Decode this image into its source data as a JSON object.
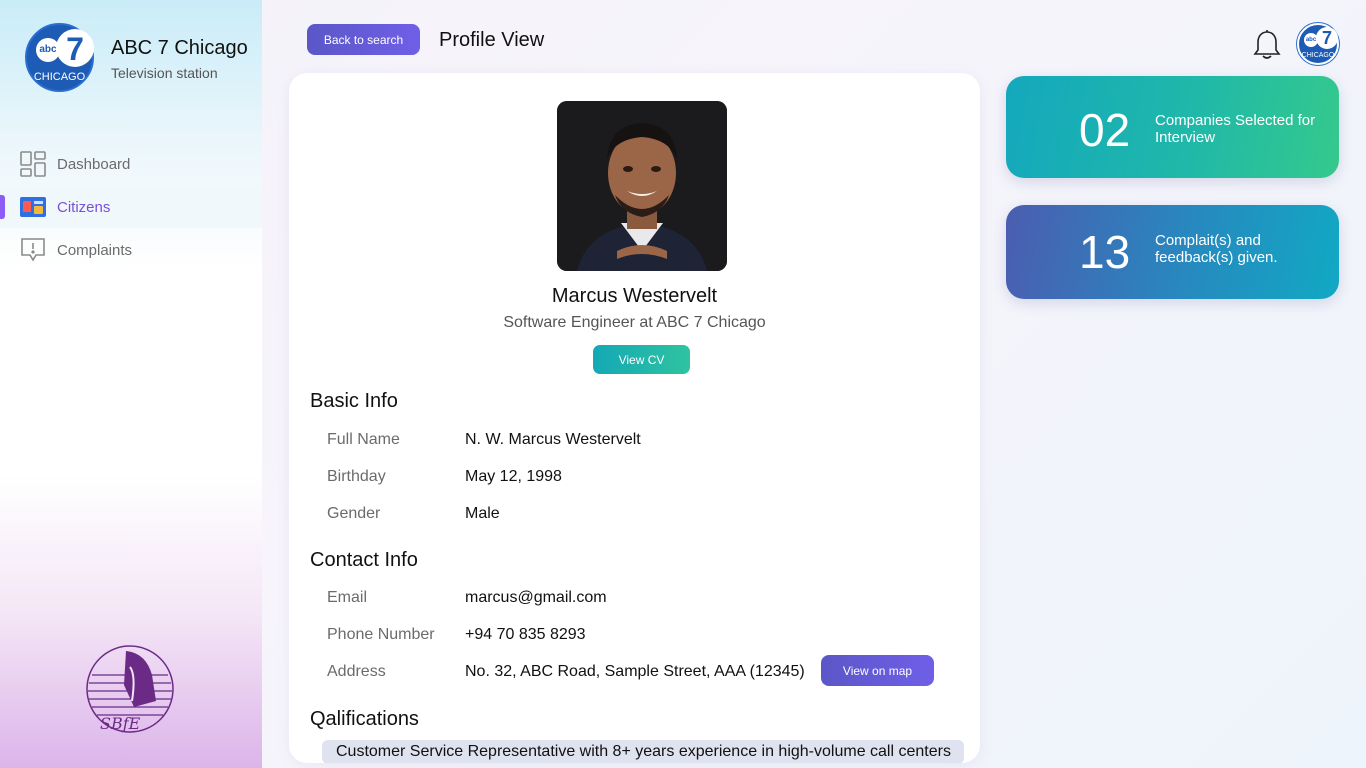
{
  "brand": {
    "name": "ABC 7 Chicago",
    "subtitle": "Television station",
    "logo_abc": "abc",
    "logo_seven": "7",
    "logo_city": "CHICAGO"
  },
  "sidebar": {
    "items": [
      {
        "label": "Dashboard",
        "icon": "dashboard-grid-icon",
        "active": false
      },
      {
        "label": "Citizens",
        "icon": "citizens-id-icon",
        "active": true
      },
      {
        "label": "Complaints",
        "icon": "complaint-bubble-icon",
        "active": false
      }
    ],
    "seal_text": "SBFE"
  },
  "header": {
    "back_label": "Back to search",
    "title": "Profile View",
    "notification_icon": "bell-icon"
  },
  "profile": {
    "name": "Marcus Westervelt",
    "role": "Software Engineer at ABC 7 Chicago",
    "cv_label": "View CV"
  },
  "basic_info": {
    "title": "Basic Info",
    "fields": [
      {
        "label": "Full Name",
        "value": "N. W. Marcus Westervelt"
      },
      {
        "label": "Birthday",
        "value": "May 12, 1998"
      },
      {
        "label": "Gender",
        "value": "Male"
      }
    ]
  },
  "contact_info": {
    "title": "Contact Info",
    "fields": [
      {
        "label": "Email",
        "value": "marcus@gmail.com"
      },
      {
        "label": "Phone Number",
        "value": "+94 70  835 8293"
      },
      {
        "label": "Address",
        "value": "No. 32, ABC Road, Sample Street,  AAA (12345)"
      }
    ],
    "map_label": "View on map"
  },
  "qualifications": {
    "title": "Qalifications",
    "items": [
      "Customer Service Representative with 8+ years experience in high-volume call centers"
    ]
  },
  "stats": [
    {
      "number": "02",
      "text": "Companies Selected for Interview"
    },
    {
      "number": "13",
      "text": "Complait(s) and feedback(s) given."
    }
  ],
  "colors": {
    "accent_purple": "#6f5fe8",
    "accent_teal": "#14a8b5",
    "active_nav": "#7a4fd8",
    "logo_blue": "#1e5bb4"
  }
}
